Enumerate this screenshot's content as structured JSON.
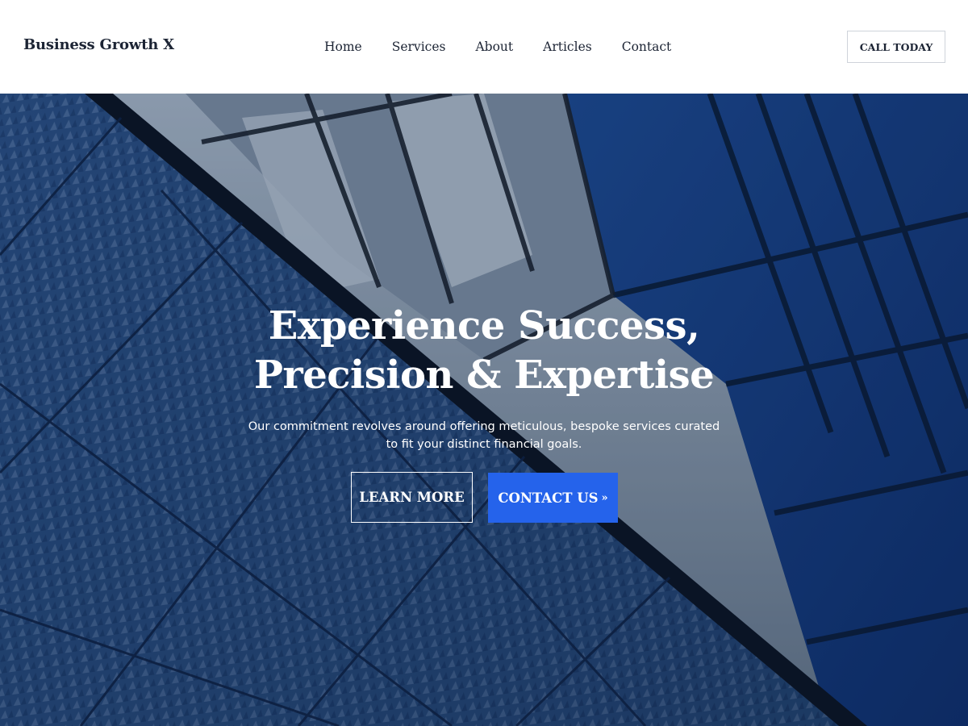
{
  "header": {
    "brand": "Business Growth X",
    "nav": [
      {
        "label": "Home"
      },
      {
        "label": "Services"
      },
      {
        "label": "About"
      },
      {
        "label": "Articles"
      },
      {
        "label": "Contact"
      }
    ],
    "cta_label": "CALL TODAY"
  },
  "hero": {
    "title_line1": "Experience Success,",
    "title_line2": "Precision & Expertise",
    "subtitle_line1": "Our commitment revolves around offering meticulous, bespoke services curated",
    "subtitle_line2": "to fit your distinct financial goals.",
    "learn_more_label": "LEARN MORE",
    "contact_label": "CONTACT US",
    "contact_arrow_icon": "double-chevron-right-icon",
    "contact_arrow_glyph": "»",
    "background_image": "modern-glass-building-facade"
  },
  "colors": {
    "text_dark": "#1c2434",
    "accent_blue": "#2563eb",
    "hero_blue": "#1c3f7a",
    "white": "#ffffff"
  }
}
